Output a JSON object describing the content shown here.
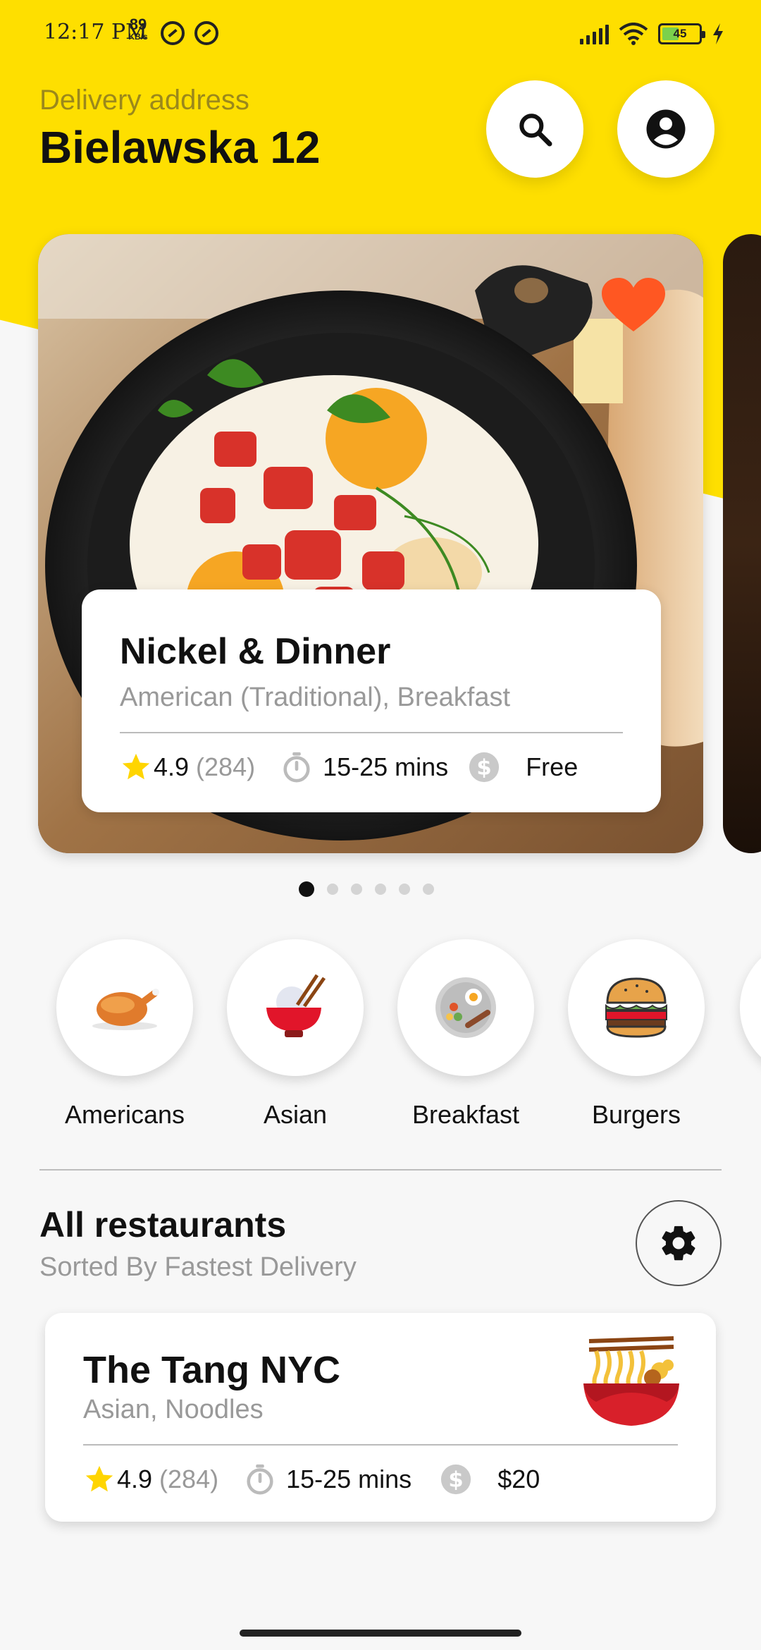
{
  "status_bar": {
    "time": "12:17 PM",
    "speed_value": "89",
    "speed_unit": "KB/s",
    "battery_level": "45",
    "battery_fraction": 0.45,
    "icons": [
      "sync-off-icon",
      "sync-off-icon",
      "signal-icon",
      "wifi-icon",
      "battery-icon",
      "charging-icon"
    ]
  },
  "header": {
    "address_label": "Delivery address",
    "address_value": "Bielawska 12",
    "search_icon": "search-icon",
    "profile_icon": "account-circle-icon"
  },
  "colors": {
    "brand_yellow": "#fedf00",
    "heart_orange": "#ff5722",
    "star_yellow": "#ffd500",
    "text_primary": "#111111",
    "text_secondary": "#999999"
  },
  "featured": {
    "name": "Nickel & Dinner",
    "cuisine": "American (Traditional), Breakfast",
    "rating": "4.9",
    "reviews": "(284)",
    "delivery_time": "15-25 mins",
    "delivery_fee": "Free",
    "favorite_icon": "heart-icon",
    "pager_count": 6,
    "pager_active": 0
  },
  "categories": [
    {
      "label": "Americans",
      "icon": "roast-chicken-icon"
    },
    {
      "label": "Asian",
      "icon": "rice-bowl-icon"
    },
    {
      "label": "Breakfast",
      "icon": "breakfast-plate-icon"
    },
    {
      "label": "Burgers",
      "icon": "burger-icon"
    }
  ],
  "all_restaurants": {
    "title": "All restaurants",
    "subtitle": "Sorted By Fastest Delivery",
    "settings_icon": "gear-icon"
  },
  "restaurants": [
    {
      "name": "The Tang NYC",
      "cuisine": "Asian, Noodles",
      "rating": "4.9",
      "reviews": "(284)",
      "delivery_time": "15-25 mins",
      "delivery_fee": "$20",
      "icon": "noodle-bowl-icon"
    }
  ]
}
